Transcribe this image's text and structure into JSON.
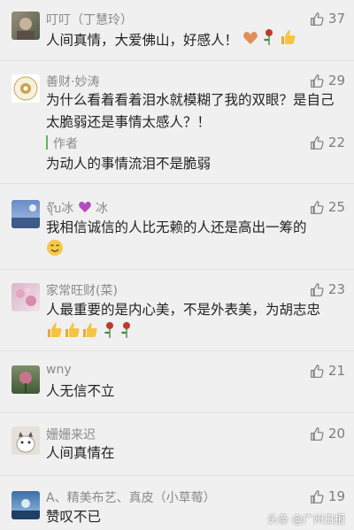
{
  "comments": [
    {
      "name": "叮叮（丁慧玲）",
      "likes": "37",
      "text": "人间真情，大爱佛山，好感人！"
    },
    {
      "name": "善财·妙涛",
      "likes": "29",
      "text": "为什么看着看着泪水就模糊了我的双眼？是自己太脆弱还是事情太感人？！",
      "reply": {
        "name": "作者",
        "likes": "22",
        "text": "为动人的事情流泪不是脆弱"
      }
    },
    {
      "name": "จุ๊บ冰",
      "name_suffix": "冰",
      "likes": "25",
      "text": "我相信诚信的人比无赖的人还是高出一筹的"
    },
    {
      "name": "家常旺财(菜)",
      "likes": "23",
      "text": "人最重要的是内心美，不是外表美，为胡志忠"
    },
    {
      "name": "wny",
      "likes": "21",
      "text": "人无信不立"
    },
    {
      "name": "姗姗来迟",
      "likes": "20",
      "text": "人间真情在"
    },
    {
      "name": "A、精美布艺、真皮（小草莓）",
      "likes": "19",
      "text": "赞叹不已"
    }
  ],
  "watermark": "头条 @广州日报",
  "colors": {
    "like_icon": "#7c7c7c",
    "reply_bar": "#5cb85c"
  }
}
